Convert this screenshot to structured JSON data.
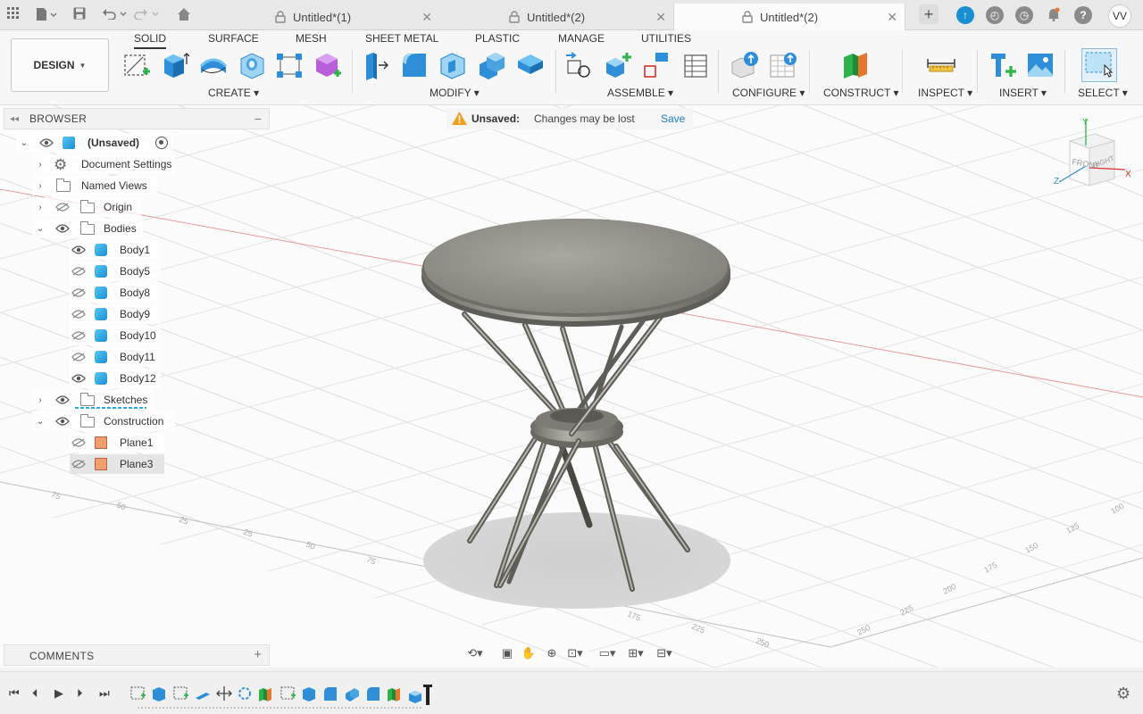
{
  "tabs": [
    {
      "label": "Untitled*(1)",
      "active": false
    },
    {
      "label": "Untitled*(2)",
      "active": false
    },
    {
      "label": "Untitled*(2)",
      "active": true
    }
  ],
  "user_initials": "VV",
  "toolbar": {
    "design_label": "DESIGN",
    "workspace_tabs": [
      "SOLID",
      "SURFACE",
      "MESH",
      "SHEET METAL",
      "PLASTIC",
      "MANAGE",
      "UTILITIES"
    ],
    "groups": [
      "CREATE",
      "MODIFY",
      "ASSEMBLE",
      "CONFIGURE",
      "CONSTRUCT",
      "INSPECT",
      "INSERT",
      "SELECT"
    ]
  },
  "browser": {
    "title": "BROWSER",
    "root": "(Unsaved)",
    "items": [
      {
        "label": "Document Settings"
      },
      {
        "label": "Named Views"
      },
      {
        "label": "Origin"
      },
      {
        "label": "Bodies"
      },
      {
        "label": "Body1"
      },
      {
        "label": "Body5"
      },
      {
        "label": "Body8"
      },
      {
        "label": "Body9"
      },
      {
        "label": "Body10"
      },
      {
        "label": "Body11"
      },
      {
        "label": "Body12"
      },
      {
        "label": "Sketches"
      },
      {
        "label": "Construction"
      },
      {
        "label": "Plane1"
      },
      {
        "label": "Plane3"
      }
    ]
  },
  "unsaved": {
    "title": "Unsaved:",
    "message": "Changes may be lost",
    "save_label": "Save"
  },
  "viewcube": {
    "front": "FRONT",
    "right": "RIGHT",
    "axes": [
      "Y",
      "X",
      "Z"
    ]
  },
  "comments_title": "COMMENTS",
  "grid_labels": [
    "75",
    "50",
    "25",
    "25",
    "50",
    "75",
    "100",
    "125",
    "150",
    "175",
    "200",
    "225",
    "250",
    "100",
    "125",
    "150",
    "175",
    "200",
    "225",
    "250"
  ]
}
